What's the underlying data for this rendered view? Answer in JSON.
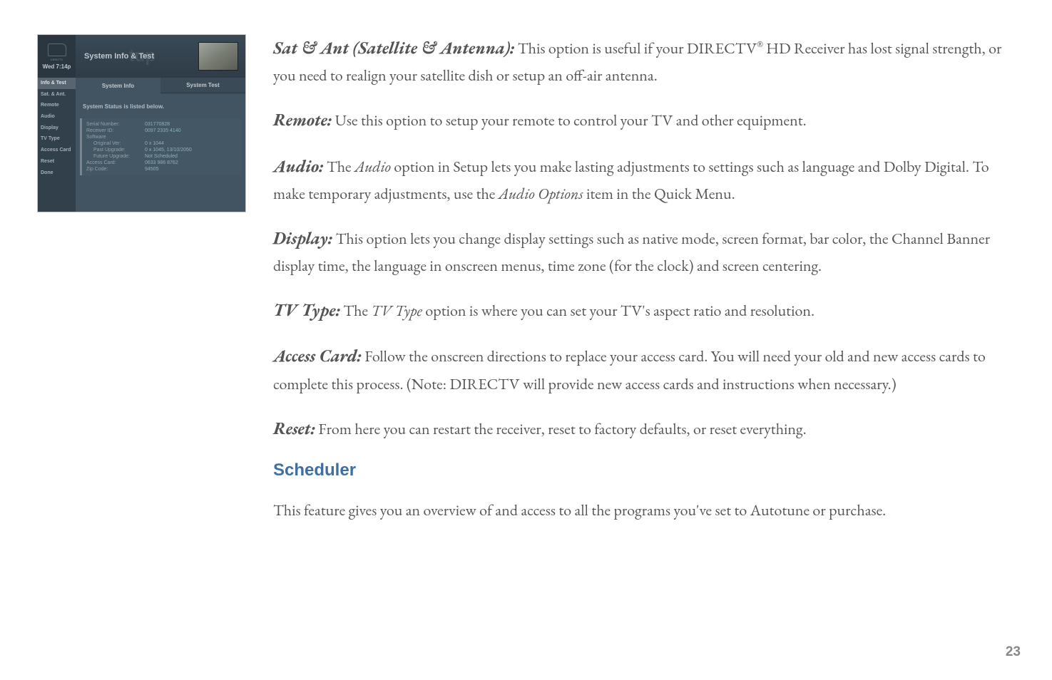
{
  "widget": {
    "logo_sub": "DIRECTV",
    "time": "Wed 7:14p",
    "title": "System Info & Test",
    "faint": "tup",
    "tabs": {
      "info": "System Info",
      "test": "System Test"
    },
    "status_line": "System Status is listed below.",
    "sidebar": {
      "info_test": "Info & Test",
      "sat_ant": "Sat. & Ant.",
      "remote": "Remote",
      "audio": "Audio",
      "display": "Display",
      "tv_type": "TV Type",
      "access_card": "Access Card",
      "reset": "Reset",
      "done": "Done"
    },
    "rows": {
      "serial": {
        "label": "Serial Number:",
        "value": "031770828"
      },
      "receiver": {
        "label": "Receiver ID:",
        "value": "0097 2335 4140"
      },
      "software": {
        "label": "Software",
        "value": ""
      },
      "orig": {
        "label": "Original Ver:",
        "value": "0 x 1044"
      },
      "past": {
        "label": "Past Upgrade:",
        "value": "0 x 1045, 13/10/2050"
      },
      "future": {
        "label": "Future Upgrade:",
        "value": "Not Scheduled"
      },
      "access": {
        "label": "Access Card:",
        "value": "0633 986 8762"
      },
      "zip": {
        "label": "Zip Code:",
        "value": "94505"
      }
    }
  },
  "content": {
    "sat_ant": {
      "term": "Sat & Ant (Satellite & Antenna):",
      "body_a": " This option is useful if your DIRECTV",
      "reg": "®",
      "body_b": " HD Receiver has lost signal strength, or you need to realign your satellite dish or setup an off-air antenna."
    },
    "remote": {
      "term": "Remote:",
      "body": " Use this option to setup your remote to control your TV and other equipment."
    },
    "audio": {
      "term": "Audio:",
      "body_a": " The ",
      "italic_a": "Audio",
      "body_b": " option in Setup lets you make lasting adjustments to settings such as language and Dolby Digital. To make temporary adjustments, use the ",
      "italic_b": "Audio Options",
      "body_c": " item in the Quick Menu."
    },
    "display": {
      "term": "Display:",
      "body": " This option lets you change display settings such as native mode, screen format, bar color, the Channel Banner display time, the language in onscreen menus, time zone (for the clock) and screen centering."
    },
    "tv_type": {
      "term": "TV Type:",
      "body_a": " The ",
      "italic_a": "TV Type",
      "body_b": " option is where you can set your TV's aspect ratio and resolution."
    },
    "access_card": {
      "term": "Access Card:",
      "body": " Follow the onscreen directions to replace your access card. You will need your old and new access cards to complete this process. (Note: DIRECTV will provide new access cards and instructions when necessary.)"
    },
    "reset": {
      "term": "Reset:",
      "body": " From here you can restart the receiver, reset to factory defaults, or reset everything."
    },
    "scheduler_heading": "Scheduler",
    "scheduler_body": "This feature gives you an overview of and access to all the programs you've set to Autotune or purchase."
  },
  "page_number": "23"
}
